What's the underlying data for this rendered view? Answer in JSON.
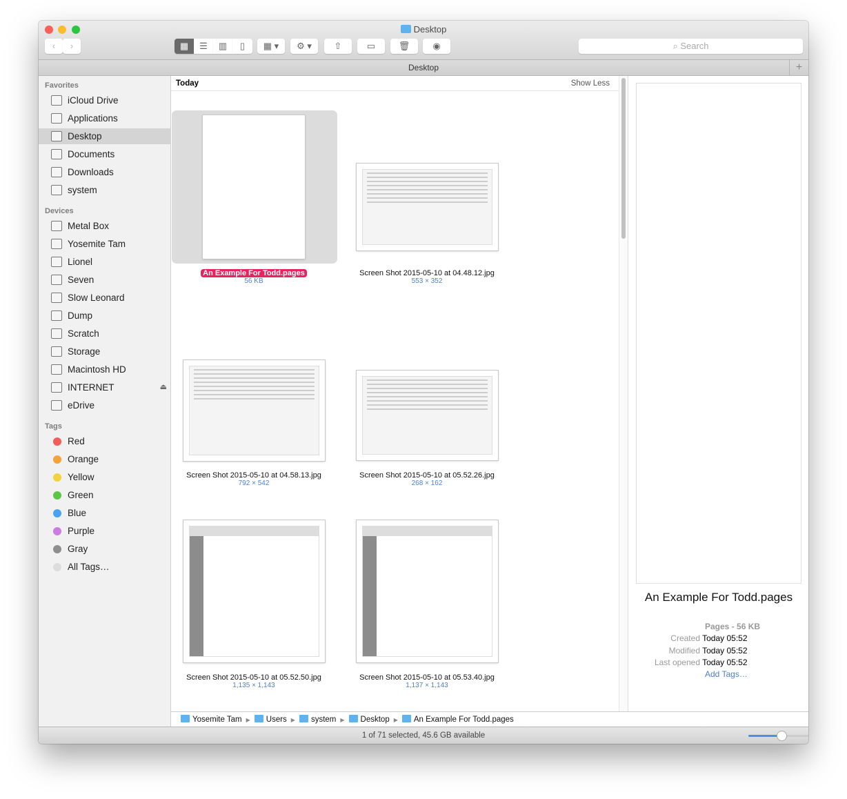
{
  "window": {
    "title": "Desktop",
    "path_title": "Desktop"
  },
  "toolbar": {
    "back": "‹",
    "forward": "›",
    "view_icon": "▦",
    "view_list": "☰",
    "view_column": "▥",
    "view_coverflow": "▯",
    "arrange": "▦ ▾",
    "action": "⚙ ▾",
    "share": "⇧",
    "tag": "▭",
    "trash": "🗑",
    "quicklook": "◉",
    "search_placeholder": "Search",
    "search_icon": "⌕",
    "add": "+"
  },
  "sidebar": {
    "favorites_header": "Favorites",
    "favorites": [
      {
        "label": "iCloud Drive"
      },
      {
        "label": "Applications"
      },
      {
        "label": "Desktop",
        "selected": true
      },
      {
        "label": "Documents"
      },
      {
        "label": "Downloads"
      },
      {
        "label": "system"
      }
    ],
    "devices_header": "Devices",
    "devices": [
      {
        "label": "Metal Box"
      },
      {
        "label": "Yosemite Tam"
      },
      {
        "label": "Lionel"
      },
      {
        "label": "Seven"
      },
      {
        "label": "Slow Leonard"
      },
      {
        "label": "Dump"
      },
      {
        "label": "Scratch"
      },
      {
        "label": "Storage"
      },
      {
        "label": "Macintosh HD"
      },
      {
        "label": "INTERNET",
        "eject": "⏏"
      },
      {
        "label": "eDrive"
      }
    ],
    "tags_header": "Tags",
    "tags": [
      {
        "label": "Red",
        "color": "#f25d57"
      },
      {
        "label": "Orange",
        "color": "#f4a33a"
      },
      {
        "label": "Yellow",
        "color": "#f3d33d"
      },
      {
        "label": "Green",
        "color": "#5cc546"
      },
      {
        "label": "Blue",
        "color": "#4aa3f0"
      },
      {
        "label": "Purple",
        "color": "#cd7de2"
      },
      {
        "label": "Gray",
        "color": "#8e8e8e"
      },
      {
        "label": "All Tags…",
        "color": "#dddddd"
      }
    ]
  },
  "content": {
    "section": "Today",
    "show_less": "Show Less",
    "items": [
      {
        "name": "An Example For Todd.pages",
        "info": "56 KB",
        "selected": true
      },
      {
        "name": "Screen Shot 2015-05-10 at 04.48.12.jpg",
        "info": "553 × 352"
      },
      {
        "name": "Screen Shot 2015-05-10 at 04.58.13.jpg",
        "info": "792 × 542"
      },
      {
        "name": "Screen Shot 2015-05-10 at 05.52.26.jpg",
        "info": "268 × 162"
      },
      {
        "name": "Screen Shot 2015-05-10 at 05.52.50.jpg",
        "info": "1,135 × 1,143"
      },
      {
        "name": "Screen Shot 2015-05-10 at 05.53.40.jpg",
        "info": "1,137 × 1,143"
      }
    ]
  },
  "preview": {
    "name": "An Example For Todd.pages",
    "kind": "Pages - 56 KB",
    "created_label": "Created",
    "created": "Today 05:52",
    "modified_label": "Modified",
    "modified": "Today 05:52",
    "opened_label": "Last opened",
    "opened": "Today 05:52",
    "add_tags": "Add Tags…"
  },
  "breadcrumb": [
    "Yosemite Tam",
    "Users",
    "system",
    "Desktop",
    "An Example For Todd.pages"
  ],
  "status": {
    "text": "1 of 71 selected, 45.6 GB available",
    "zoom": 0.55
  }
}
